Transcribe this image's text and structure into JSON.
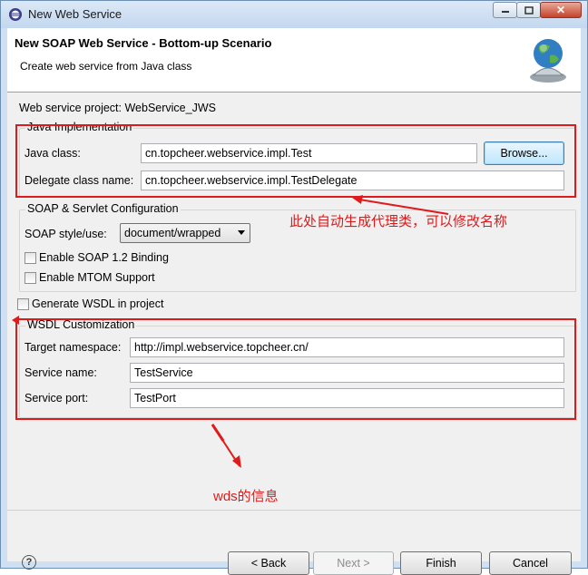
{
  "window": {
    "title": "New Web Service",
    "minimize_icon": "minimize-icon",
    "maximize_icon": "maximize-icon",
    "close_icon": "close-icon"
  },
  "banner": {
    "title": "New SOAP Web Service - Bottom-up Scenario",
    "subtitle": "Create web service from Java class",
    "icon": "web-service-globe-icon"
  },
  "project": {
    "label": "Web service project: WebService_JWS"
  },
  "java_impl": {
    "group_title": "Java Implementation",
    "java_class_label": "Java class:",
    "java_class_value": "cn.topcheer.webservice.impl.Test",
    "browse_label": "Browse...",
    "delegate_label": "Delegate class name:",
    "delegate_value": "cn.topcheer.webservice.impl.TestDelegate"
  },
  "soap": {
    "group_title": "SOAP & Servlet Configuration",
    "style_label": "SOAP style/use:",
    "style_value": "document/wrapped",
    "soap12_label": "Enable SOAP 1.2 Binding",
    "mtom_label": "Enable MTOM Support"
  },
  "generate_wsdl_label": "Generate WSDL in project",
  "wsdl": {
    "group_title": "WSDL Customization",
    "namespace_label": "Target namespace:",
    "namespace_value": "http://impl.webservice.topcheer.cn/",
    "service_label": "Service name:",
    "service_value": "TestService",
    "port_label": "Service port:",
    "port_value": "TestPort"
  },
  "annotations": {
    "delegate_note": "此处自动生成代理类，可以修改名称",
    "wsdl_note": "wds的信息"
  },
  "buttons": {
    "help_glyph": "?",
    "back": "< Back",
    "next": "Next >",
    "finish": "Finish",
    "cancel": "Cancel"
  },
  "colors": {
    "annotation_red": "#e01a1a"
  }
}
